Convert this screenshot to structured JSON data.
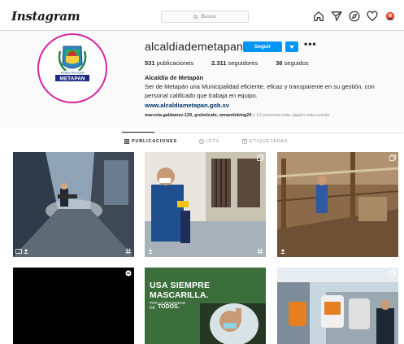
{
  "nav": {
    "logo": "Instagram",
    "search_placeholder": "Busca",
    "icons": [
      "home-icon",
      "direct-icon",
      "explore-icon",
      "activity-heart-icon",
      "profile-avatar-icon"
    ]
  },
  "profile": {
    "username": "alcaldiademetapan",
    "follow_label": "Seguir",
    "more_label": "•••",
    "stats": {
      "posts_count": "531",
      "posts_label": "publicaciones",
      "followers_count": "2.311",
      "followers_label": "seguidores",
      "following_count": "36",
      "following_label": "seguidos"
    },
    "full_name": "Alcaldía de Metapán",
    "bio": "Ser de Metapán una Municipalidad eficiente, eficaz y transparente en su gestión, con personal calificado que trabaja en equipo.",
    "website": "www.alcaldiametapan.gob.sv",
    "followed_by_names": "marcela.galdamez.129, grebelcafe, wmandoking24",
    "followed_by_rest": " y 10 personas más siguen esta cuenta",
    "avatar_text": {
      "top": "Alcaldía Municipal",
      "bottom": "METAPAN"
    }
  },
  "tabs": [
    {
      "label": "PUBLICACIONES",
      "active": true
    },
    {
      "label": "IGTV",
      "active": false
    },
    {
      "label": "ETIQUETADAS",
      "active": false
    }
  ],
  "posts": {
    "overlay_line1": "USA SIEMPRE",
    "overlay_line2": "MASCARILLA.",
    "overlay_line3": "POR LA SEGURIDAD",
    "overlay_line4": "DE",
    "overlay_line5": "TODOS."
  },
  "colors": {
    "accent_blue": "#0095f6",
    "link_blue": "#00376b",
    "avatar_ring": "#d6249f"
  }
}
